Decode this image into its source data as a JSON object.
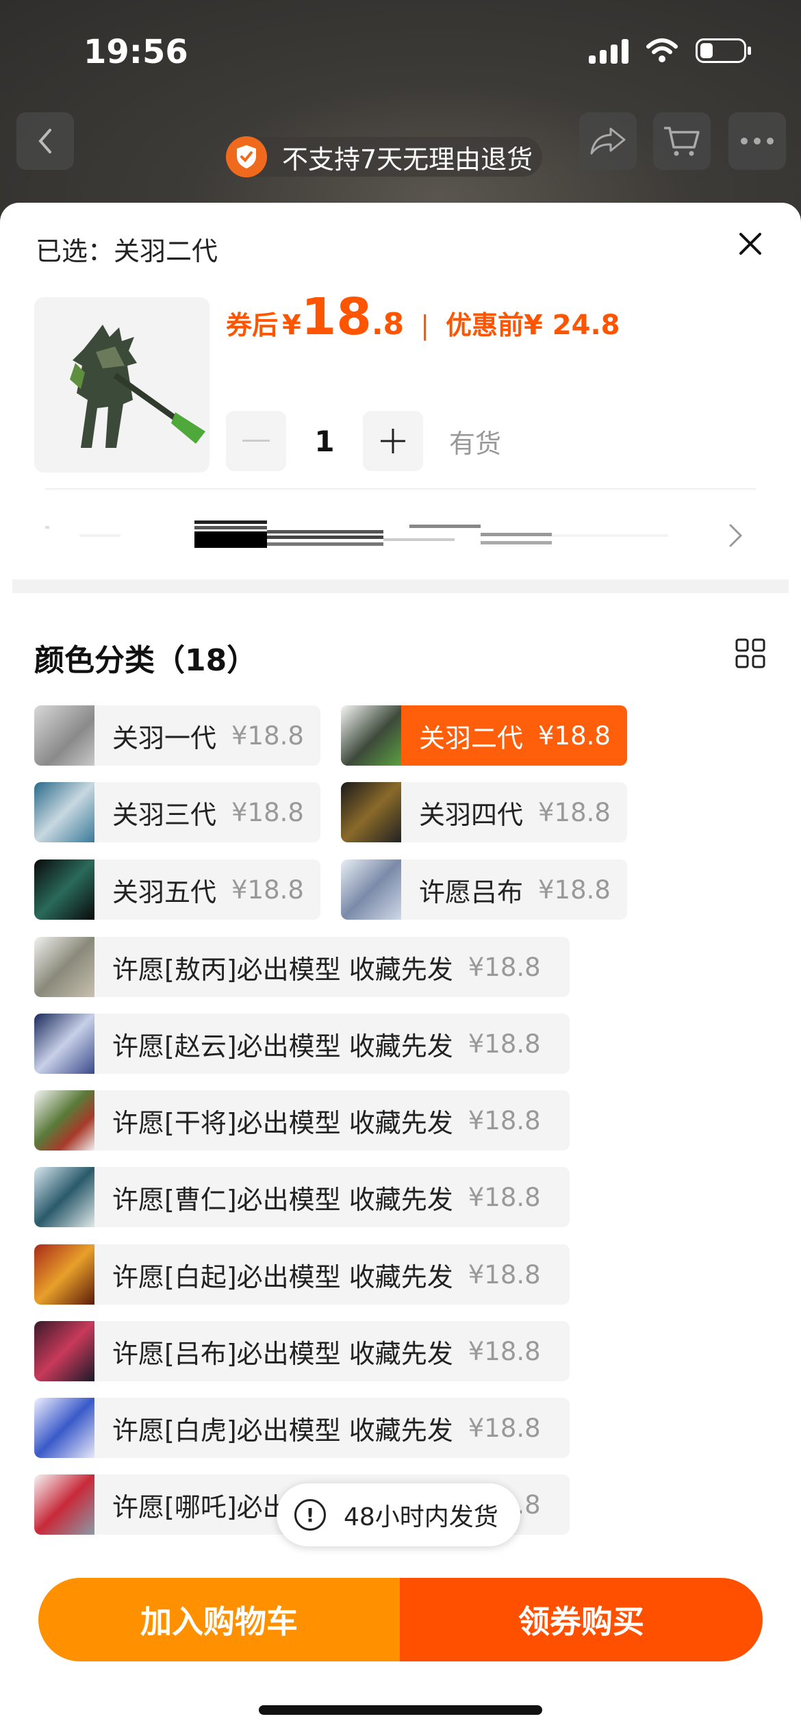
{
  "status": {
    "time": "19:56"
  },
  "banner": {
    "return_policy": "不支持7天无理由退货"
  },
  "sheet": {
    "selected_prefix": "已选：",
    "selected_value": "关羽二代",
    "price": {
      "coupon_label": "券后",
      "currency": "¥",
      "coupon_int": "18",
      "coupon_dec": ".8",
      "separator": "|",
      "before_label": "优惠前",
      "before_price": "¥ 24.8"
    },
    "quantity": "1",
    "stock": "有货"
  },
  "options": {
    "title": "颜色分类（18）",
    "items": [
      {
        "name": "关羽一代",
        "price": "¥18.8"
      },
      {
        "name": "关羽二代",
        "price": "¥18.8"
      },
      {
        "name": "关羽三代",
        "price": "¥18.8"
      },
      {
        "name": "关羽四代",
        "price": "¥18.8"
      },
      {
        "name": "关羽五代",
        "price": "¥18.8"
      },
      {
        "name": "许愿吕布",
        "price": "¥18.8"
      },
      {
        "name": "许愿[敖丙]必出模型 收藏先发",
        "price": "¥18.8"
      },
      {
        "name": "许愿[赵云]必出模型 收藏先发",
        "price": "¥18.8"
      },
      {
        "name": "许愿[干将]必出模型 收藏先发",
        "price": "¥18.8"
      },
      {
        "name": "许愿[曹仁]必出模型 收藏先发",
        "price": "¥18.8"
      },
      {
        "name": "许愿[白起]必出模型 收藏先发",
        "price": "¥18.8"
      },
      {
        "name": "许愿[吕布]必出模型 收藏先发",
        "price": "¥18.8"
      },
      {
        "name": "许愿[白虎]必出模型 收藏先发",
        "price": "¥18.8"
      },
      {
        "name": "许愿[哪吒]必出模型 收藏先发",
        "price": "¥18.8"
      }
    ]
  },
  "toast": {
    "text": "48小时内发货"
  },
  "actions": {
    "add_to_cart": "加入购物车",
    "buy": "领券购买"
  },
  "colors": {
    "accent": "#ff5500",
    "cart_button": "#ff9000",
    "buy_button": "#ff5000"
  }
}
